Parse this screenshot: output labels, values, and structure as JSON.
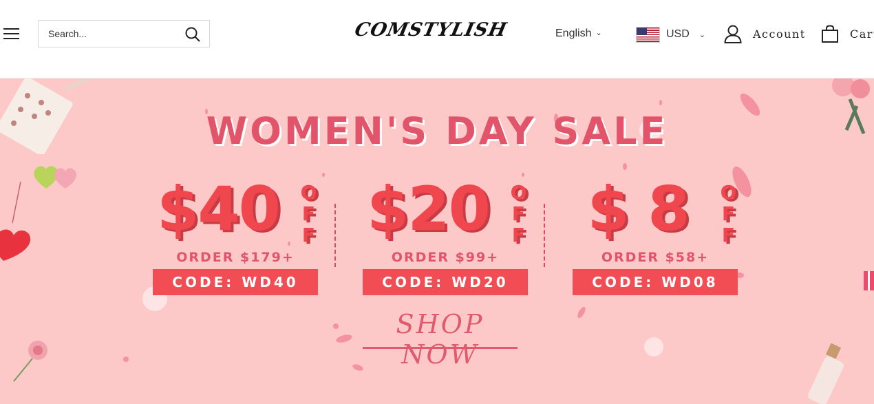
{
  "header": {
    "search_placeholder": "Search...",
    "logo": "COMSTYLISH",
    "language": "English",
    "currency": "USD",
    "account_label": "Account",
    "cart_label": "Cart"
  },
  "banner": {
    "headline": "WOMEN'S DAY SALE",
    "off_label": "OFF",
    "offers": [
      {
        "amount": "$40",
        "minimum": "ORDER $179+",
        "code": "CODE: WD40"
      },
      {
        "amount": "$20",
        "minimum": "ORDER $99+",
        "code": "CODE: WD20"
      },
      {
        "amount": "$ 8",
        "minimum": "ORDER $58+",
        "code": "CODE: WD08"
      }
    ],
    "cta": "SHOP NOW"
  },
  "colors": {
    "banner_bg": "#fcc9c8",
    "accent_red": "#f24d55",
    "headline_pink": "#e2546a"
  }
}
